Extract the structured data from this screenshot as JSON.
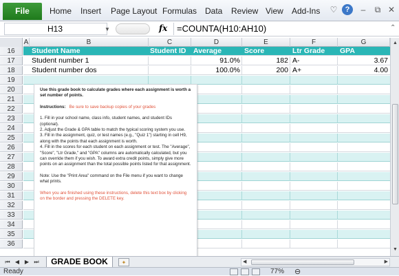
{
  "ribbon": {
    "file_label": "File",
    "tabs": [
      "Home",
      "Insert",
      "Page Layout",
      "Formulas",
      "Data",
      "Review",
      "View",
      "Add-Ins"
    ]
  },
  "formula_bar": {
    "name_box": "H13",
    "fx_label": "fx",
    "formula": "=COUNTA(H10:AH10)"
  },
  "columns": [
    "A",
    "B",
    "C",
    "D",
    "E",
    "F",
    "G"
  ],
  "rows": [
    "16",
    "17",
    "18",
    "19",
    "20",
    "21",
    "22",
    "23",
    "24",
    "25",
    "26",
    "27",
    "28",
    "29",
    "30",
    "31",
    "32",
    "33",
    "34",
    "35",
    "36"
  ],
  "table": {
    "headers": [
      "Student Name",
      "Student ID",
      "Average",
      "Score",
      "Ltr Grade",
      "GPA"
    ],
    "data": [
      {
        "name": "Student number 1",
        "id": "",
        "average": "91.0%",
        "score": "182",
        "ltr": "A-",
        "gpa": "3.67"
      },
      {
        "name": "Student number dos",
        "id": "",
        "average": "100.0%",
        "score": "200",
        "ltr": "A+",
        "gpa": "4.00"
      }
    ]
  },
  "textbox": {
    "intro": "Use this grade book to calculate grades where each assignment  is worth a set number of points.",
    "instructions_label": "Instructions:",
    "instructions_note": "Be sure to save backup copies of your grades",
    "step1": "1. Fill in your school name, class info, student names, and student IDs (optional).",
    "step2": "2. Adjust the Grade & GPA table to match the typical scoring system you use.",
    "step3": "3. Fill in the assignment, quiz, or test names (e.g., \"Quiz 1\") starting in cell H9, along with the points that each assignment is worth.",
    "step4": "4. Fill in the scores for each student on each assignment or test. The \"Average\", \"Score\", \"Ltr Grade,\" and \"GPA\" columns are automatically calculated, but you can override them if you wish. To award extra credit points, simply give more points on an assignment than the total possible points listed for that assignment.",
    "note": "Note: Use the \"Print Area\" command on the File menu if you want to change what prints.",
    "finish": "When you are finished using these instructions, delete this text box by clicking on the border and pressing the DELETE key."
  },
  "sheet_tabs": {
    "active": "GRADE BOOK"
  },
  "status": {
    "ready": "Ready",
    "zoom": "77%"
  },
  "colors": {
    "header_teal": "#2ab6b6",
    "row_teal": "#d9f2f2",
    "file_green": "#2b8a28",
    "red_note": "#e0523a"
  }
}
